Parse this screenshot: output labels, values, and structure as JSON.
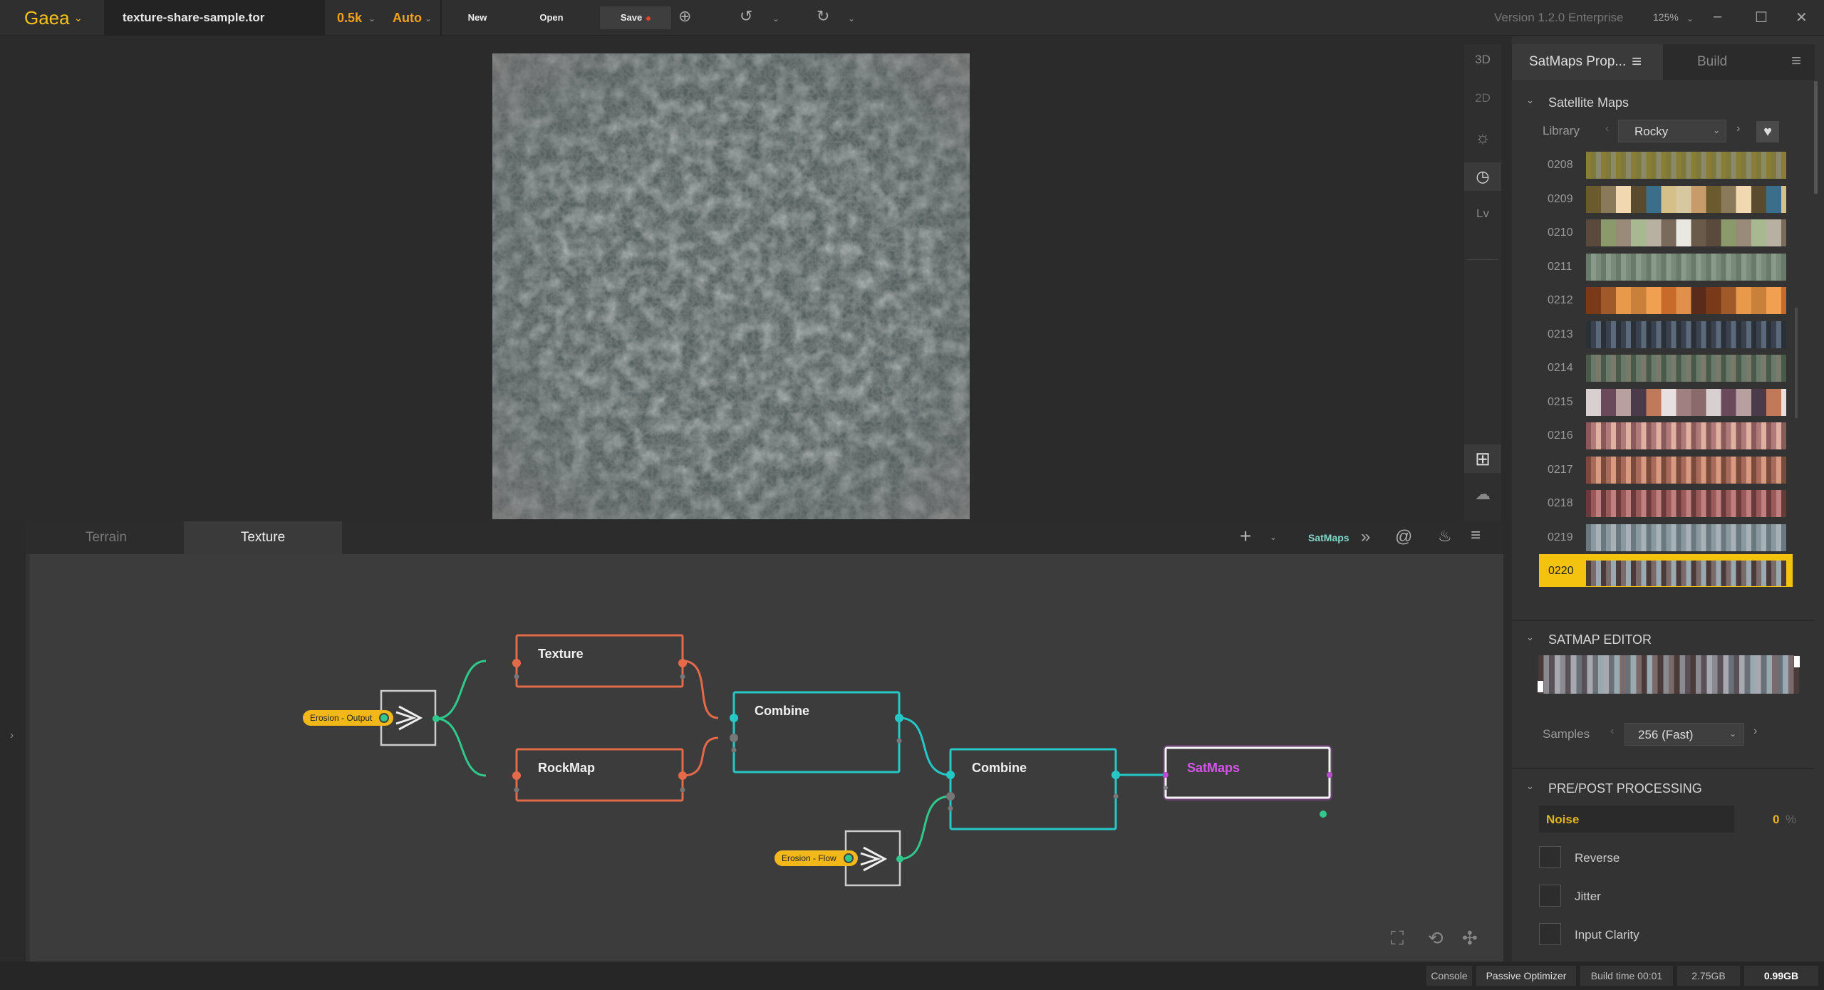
{
  "app": {
    "logo": "Gaea",
    "file_name": "texture-share-sample.tor",
    "resolution": "0.5k",
    "build_mode": "Auto",
    "new_label": "New",
    "open_label": "Open",
    "save_label": "Save",
    "version": "Version 1.2.0 Enterprise",
    "zoom": "125%"
  },
  "view_toolbar": {
    "mode_3d": "3D",
    "mode_2d": "2D",
    "level": "Lv"
  },
  "graph": {
    "tabs": [
      {
        "label": "Terrain"
      },
      {
        "label": "Texture"
      }
    ],
    "toolbar_label": "SatMaps",
    "nodes": {
      "texture": "Texture",
      "rockmap": "RockMap",
      "combine1": "Combine",
      "combine2": "Combine",
      "satmaps": "SatMaps"
    },
    "tags": {
      "erosion_output": "Erosion - Output",
      "erosion_flow": "Erosion - Flow"
    }
  },
  "right_panel": {
    "tabs": [
      {
        "label": "SatMaps Prop..."
      },
      {
        "label": "Build"
      }
    ],
    "satellite_maps": {
      "heading": "Satellite Maps",
      "library_label": "Library",
      "library_value": "Rocky",
      "rows": [
        {
          "id": "0208"
        },
        {
          "id": "0209"
        },
        {
          "id": "0210"
        },
        {
          "id": "0211"
        },
        {
          "id": "0212"
        },
        {
          "id": "0213"
        },
        {
          "id": "0214"
        },
        {
          "id": "0215"
        },
        {
          "id": "0216"
        },
        {
          "id": "0217"
        },
        {
          "id": "0218"
        },
        {
          "id": "0219"
        },
        {
          "id": "0220"
        }
      ]
    },
    "satmap_editor": {
      "heading": "SATMAP EDITOR",
      "samples_label": "Samples",
      "samples_value": "256 (Fast)"
    },
    "processing": {
      "heading": "PRE/POST PROCESSING",
      "noise_label": "Noise",
      "noise_value": "0",
      "noise_unit": "%",
      "reverse": "Reverse",
      "jitter": "Jitter",
      "input_clarity": "Input Clarity"
    }
  },
  "status": {
    "console": "Console",
    "optimizer": "Passive Optimizer",
    "build_time": "Build time 00:01",
    "memory1": "2.75GB",
    "memory2": "0.99GB"
  }
}
